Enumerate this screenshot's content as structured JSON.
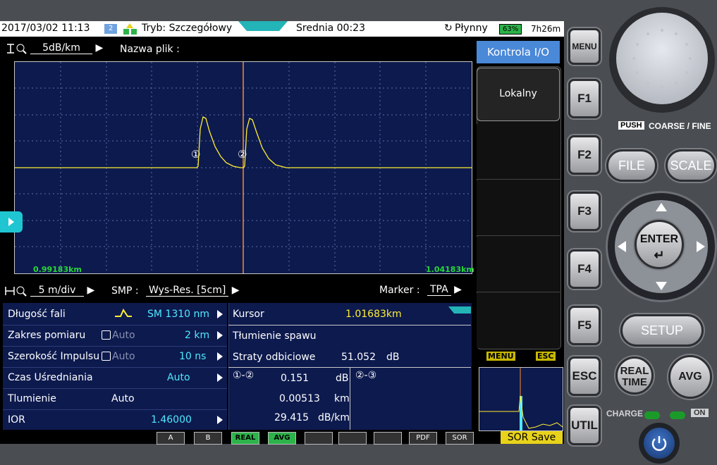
{
  "status": {
    "datetime": "2017/03/02 11:13",
    "badge": "2",
    "mode": "Tryb: Szczegółowy",
    "average": "Srednia 00:23",
    "smooth": "Płynny",
    "battery": "63%",
    "battery_time": "7h26m"
  },
  "toolbar_top": {
    "scale": "5dB/km",
    "filename_label": "Nazwa plik :"
  },
  "graph": {
    "x_start": "0.99183km",
    "x_end": "1.04183km",
    "marker1": "①",
    "marker2": "②"
  },
  "toolbar_mid": {
    "hscale": "5 m/div",
    "smp_label": "SMP :",
    "smp_value": "Wys-Res. [5cm]",
    "marker_label": "Marker :",
    "marker_value": "TPA"
  },
  "settings": [
    {
      "label": "Długość fali",
      "value": "SM 1310 nm",
      "extra": ""
    },
    {
      "label": "Zakres pomiaru",
      "value": "2 km",
      "extra": "Auto"
    },
    {
      "label": "Szerokość Impulsu",
      "value": "10 ns",
      "extra": "Auto"
    },
    {
      "label": "Czas Uśredniania",
      "value": "Auto",
      "extra": ""
    },
    {
      "label": "Tlumienie",
      "value": "Auto",
      "extra": ""
    },
    {
      "label": "IOR",
      "value": "1.46000",
      "extra": ""
    }
  ],
  "results": {
    "cursor_label": "Kursor",
    "cursor_value": "1.01683km",
    "splice_label": "Tłumienie spawu",
    "return_loss_label": "Straty odbiciowe",
    "return_loss_value": "51.052",
    "return_loss_unit": "dB",
    "pair12": "①-②",
    "pair23": "②-③",
    "v1": "0.151",
    "u1": "dB",
    "v2": "0.00513",
    "u2": "km",
    "v3": "29.415",
    "u3": "dB/km"
  },
  "side_menu": {
    "title": "Kontrola I/O",
    "f1": "Lokalny"
  },
  "mini": {
    "menu": "MENU",
    "esc": "ESC"
  },
  "bottom_icons": [
    "A",
    "B",
    "REAL",
    "AVG",
    "",
    "",
    "",
    "PDF",
    "SOR"
  ],
  "sor_save": "SOR Save",
  "hardware": {
    "menu": "MENU",
    "f1": "F1",
    "f2": "F2",
    "f3": "F3",
    "f4": "F4",
    "f5": "F5",
    "esc": "ESC",
    "util": "UTIL",
    "push": "PUSH",
    "coarse_fine": "COARSE / FINE",
    "file": "FILE",
    "scale": "SCALE",
    "enter": "ENTER",
    "setup": "SETUP",
    "real": "REAL",
    "time": "TIME",
    "avg": "AVG",
    "charge": "CHARGE",
    "on": "ON"
  },
  "colors": {
    "trace": "#ffee33",
    "cursor": "#ff8a2a",
    "grid_bg": "#0d1a4e",
    "accent": "#4fe9ff"
  }
}
